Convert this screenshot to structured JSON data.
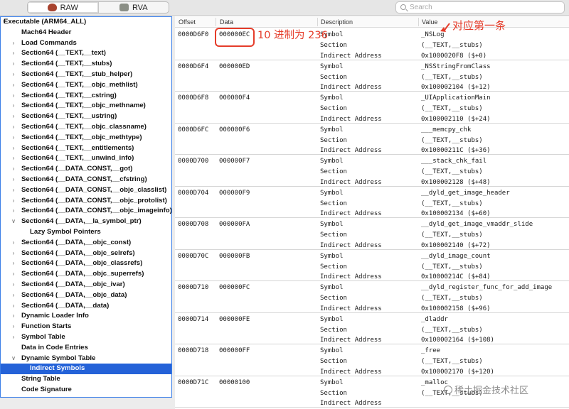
{
  "toolbar": {
    "tabs": [
      {
        "label": "RAW",
        "icon": "raw-icon"
      },
      {
        "label": "RVA",
        "icon": "rva-icon"
      }
    ],
    "search": {
      "placeholder": "Search",
      "value": ""
    }
  },
  "sidebar": {
    "items": [
      {
        "label": "Executable  (ARM64_ALL)",
        "level": 0,
        "disclosure": "open"
      },
      {
        "label": "Mach64 Header",
        "level": 1,
        "disclosure": "none"
      },
      {
        "label": "Load Commands",
        "level": 1,
        "disclosure": "closed"
      },
      {
        "label": "Section64 (__TEXT,__text)",
        "level": 1,
        "disclosure": "closed"
      },
      {
        "label": "Section64 (__TEXT,__stubs)",
        "level": 1,
        "disclosure": "closed"
      },
      {
        "label": "Section64 (__TEXT,__stub_helper)",
        "level": 1,
        "disclosure": "closed"
      },
      {
        "label": "Section64 (__TEXT,__objc_methlist)",
        "level": 1,
        "disclosure": "closed"
      },
      {
        "label": "Section64 (__TEXT,__cstring)",
        "level": 1,
        "disclosure": "closed"
      },
      {
        "label": "Section64 (__TEXT,__objc_methname)",
        "level": 1,
        "disclosure": "closed"
      },
      {
        "label": "Section64 (__TEXT,__ustring)",
        "level": 1,
        "disclosure": "closed"
      },
      {
        "label": "Section64 (__TEXT,__objc_classname)",
        "level": 1,
        "disclosure": "closed"
      },
      {
        "label": "Section64 (__TEXT,__objc_methtype)",
        "level": 1,
        "disclosure": "closed"
      },
      {
        "label": "Section64 (__TEXT,__entitlements)",
        "level": 1,
        "disclosure": "closed"
      },
      {
        "label": "Section64 (__TEXT,__unwind_info)",
        "level": 1,
        "disclosure": "closed"
      },
      {
        "label": "Section64 (__DATA_CONST,__got)",
        "level": 1,
        "disclosure": "closed"
      },
      {
        "label": "Section64 (__DATA_CONST,__cfstring)",
        "level": 1,
        "disclosure": "closed"
      },
      {
        "label": "Section64 (__DATA_CONST,__objc_classlist)",
        "level": 1,
        "disclosure": "closed"
      },
      {
        "label": "Section64 (__DATA_CONST,__objc_protolist)",
        "level": 1,
        "disclosure": "closed"
      },
      {
        "label": "Section64 (__DATA_CONST,__objc_imageinfo)",
        "level": 1,
        "disclosure": "closed"
      },
      {
        "label": "Section64 (__DATA,__la_symbol_ptr)",
        "level": 1,
        "disclosure": "open"
      },
      {
        "label": "Lazy Symbol Pointers",
        "level": 2,
        "disclosure": "none"
      },
      {
        "label": "Section64 (__DATA,__objc_const)",
        "level": 1,
        "disclosure": "closed"
      },
      {
        "label": "Section64 (__DATA,__objc_selrefs)",
        "level": 1,
        "disclosure": "closed"
      },
      {
        "label": "Section64 (__DATA,__objc_classrefs)",
        "level": 1,
        "disclosure": "closed"
      },
      {
        "label": "Section64 (__DATA,__objc_superrefs)",
        "level": 1,
        "disclosure": "closed"
      },
      {
        "label": "Section64 (__DATA,__objc_ivar)",
        "level": 1,
        "disclosure": "closed"
      },
      {
        "label": "Section64 (__DATA,__objc_data)",
        "level": 1,
        "disclosure": "closed"
      },
      {
        "label": "Section64 (__DATA,__data)",
        "level": 1,
        "disclosure": "closed"
      },
      {
        "label": "Dynamic Loader Info",
        "level": 1,
        "disclosure": "closed"
      },
      {
        "label": "Function Starts",
        "level": 1,
        "disclosure": "closed"
      },
      {
        "label": "Symbol Table",
        "level": 1,
        "disclosure": "closed"
      },
      {
        "label": "Data in Code Entries",
        "level": 1,
        "disclosure": "none"
      },
      {
        "label": "Dynamic Symbol Table",
        "level": 1,
        "disclosure": "open"
      },
      {
        "label": "Indirect Symbols",
        "level": 2,
        "disclosure": "none",
        "selected": true
      },
      {
        "label": "String Table",
        "level": 1,
        "disclosure": "none"
      },
      {
        "label": "Code Signature",
        "level": 1,
        "disclosure": "none"
      }
    ]
  },
  "table": {
    "columns": [
      "Offset",
      "Data",
      "Description",
      "Value"
    ],
    "rows": [
      {
        "offset": "0000D6F0",
        "data": "000000EC",
        "lines": [
          [
            "Symbol",
            "_NSLog"
          ],
          [
            "Section",
            "(__TEXT,__stubs)"
          ],
          [
            "Indirect Address",
            "0x1000020F8 ($+0)"
          ]
        ]
      },
      {
        "offset": "0000D6F4",
        "data": "000000ED",
        "lines": [
          [
            "Symbol",
            "_NSStringFromClass"
          ],
          [
            "Section",
            "(__TEXT,__stubs)"
          ],
          [
            "Indirect Address",
            "0x100002104 ($+12)"
          ]
        ]
      },
      {
        "offset": "0000D6F8",
        "data": "000000F4",
        "lines": [
          [
            "Symbol",
            "_UIApplicationMain"
          ],
          [
            "Section",
            "(__TEXT,__stubs)"
          ],
          [
            "Indirect Address",
            "0x100002110 ($+24)"
          ]
        ]
      },
      {
        "offset": "0000D6FC",
        "data": "000000F6",
        "lines": [
          [
            "Symbol",
            "___memcpy_chk"
          ],
          [
            "Section",
            "(__TEXT,__stubs)"
          ],
          [
            "Indirect Address",
            "0x10000211C ($+36)"
          ]
        ]
      },
      {
        "offset": "0000D700",
        "data": "000000F7",
        "lines": [
          [
            "Symbol",
            "___stack_chk_fail"
          ],
          [
            "Section",
            "(__TEXT,__stubs)"
          ],
          [
            "Indirect Address",
            "0x100002128 ($+48)"
          ]
        ]
      },
      {
        "offset": "0000D704",
        "data": "000000F9",
        "lines": [
          [
            "Symbol",
            "__dyld_get_image_header"
          ],
          [
            "Section",
            "(__TEXT,__stubs)"
          ],
          [
            "Indirect Address",
            "0x100002134 ($+60)"
          ]
        ]
      },
      {
        "offset": "0000D708",
        "data": "000000FA",
        "lines": [
          [
            "Symbol",
            "__dyld_get_image_vmaddr_slide"
          ],
          [
            "Section",
            "(__TEXT,__stubs)"
          ],
          [
            "Indirect Address",
            "0x100002140 ($+72)"
          ]
        ]
      },
      {
        "offset": "0000D70C",
        "data": "000000FB",
        "lines": [
          [
            "Symbol",
            "__dyld_image_count"
          ],
          [
            "Section",
            "(__TEXT,__stubs)"
          ],
          [
            "Indirect Address",
            "0x10000214C ($+84)"
          ]
        ]
      },
      {
        "offset": "0000D710",
        "data": "000000FC",
        "lines": [
          [
            "Symbol",
            "__dyld_register_func_for_add_image"
          ],
          [
            "Section",
            "(__TEXT,__stubs)"
          ],
          [
            "Indirect Address",
            "0x100002158 ($+96)"
          ]
        ]
      },
      {
        "offset": "0000D714",
        "data": "000000FE",
        "lines": [
          [
            "Symbol",
            "_dladdr"
          ],
          [
            "Section",
            "(__TEXT,__stubs)"
          ],
          [
            "Indirect Address",
            "0x100002164 ($+108)"
          ]
        ]
      },
      {
        "offset": "0000D718",
        "data": "000000FF",
        "lines": [
          [
            "Symbol",
            "_free"
          ],
          [
            "Section",
            "(__TEXT,__stubs)"
          ],
          [
            "Indirect Address",
            "0x100002170 ($+120)"
          ]
        ]
      },
      {
        "offset": "0000D71C",
        "data": "00000100",
        "lines": [
          [
            "Symbol",
            "_malloc"
          ],
          [
            "Section",
            "(__TEXT,__stubs)"
          ],
          [
            "Indirect Address",
            ""
          ]
        ]
      }
    ]
  },
  "annotations": {
    "decimal_note": "10 进制为 236",
    "first_entry_note": "对应第一条",
    "color": "#e53c2a"
  },
  "watermark": {
    "text": "稀土掘金技术社区"
  }
}
